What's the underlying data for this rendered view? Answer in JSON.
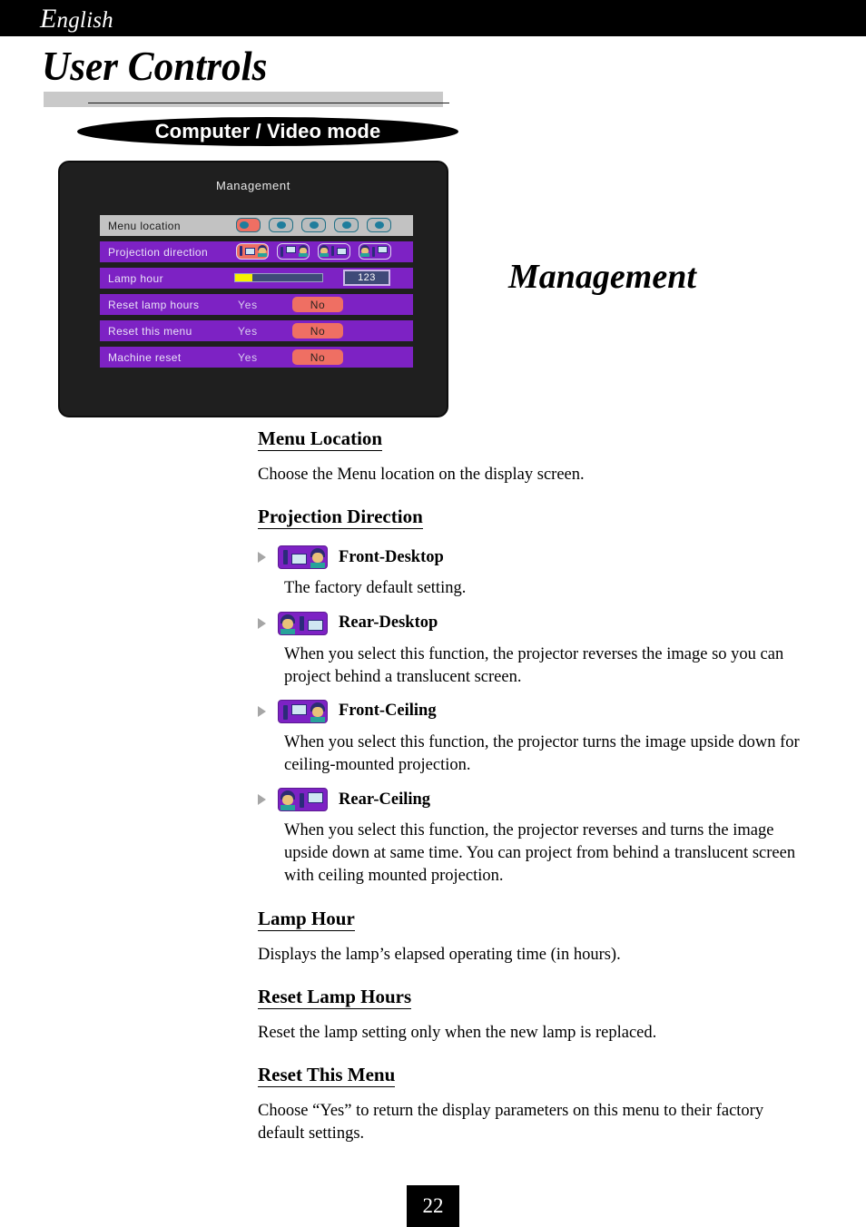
{
  "header": {
    "language": "English",
    "language_cap": "E",
    "language_rest": "nglish",
    "page_title": "User Controls",
    "mode_banner": "Computer / Video mode"
  },
  "side_heading": "Management",
  "osd": {
    "title": "Management",
    "rows": [
      {
        "label": "Menu location",
        "type": "menu-location",
        "selected": true,
        "options": [
          {
            "dot": "left",
            "active": true
          },
          {
            "dot": "center",
            "active": false
          },
          {
            "dot": "center",
            "active": false
          },
          {
            "dot": "center",
            "active": false
          },
          {
            "dot": "center",
            "active": false
          }
        ]
      },
      {
        "label": "Projection direction",
        "type": "projection-direction",
        "selected": false,
        "options": [
          {
            "mode": "front-desktop",
            "active": true
          },
          {
            "mode": "front-ceiling",
            "active": false
          },
          {
            "mode": "rear-desktop",
            "active": false
          },
          {
            "mode": "rear-ceiling",
            "active": false
          }
        ]
      },
      {
        "label": "Lamp hour",
        "type": "lamp-hour",
        "selected": false,
        "fill_percent": 20,
        "value": "123"
      },
      {
        "label": "Reset lamp hours",
        "type": "yes-no",
        "selected": false,
        "yes_label": "Yes",
        "no_label": "No",
        "chosen": "No"
      },
      {
        "label": "Reset this menu",
        "type": "yes-no",
        "selected": false,
        "yes_label": "Yes",
        "no_label": "No",
        "chosen": "No"
      },
      {
        "label": "Machine reset",
        "type": "yes-no",
        "selected": false,
        "yes_label": "Yes",
        "no_label": "No",
        "chosen": "No"
      }
    ]
  },
  "sections": {
    "menu_location": {
      "heading": "Menu Location",
      "body": "Choose the Menu location on the display screen."
    },
    "projection_direction": {
      "heading": "Projection Direction",
      "items": [
        {
          "icon": "front-desktop-icon",
          "label": "Front-Desktop",
          "body": "The factory default setting."
        },
        {
          "icon": "rear-desktop-icon",
          "label": "Rear-Desktop",
          "body": "When you select this function, the projector reverses the image so you can project behind a translucent screen."
        },
        {
          "icon": "front-ceiling-icon",
          "label": "Front-Ceiling",
          "body": "When you select this function, the projector turns the image upside down for ceiling-mounted projection."
        },
        {
          "icon": "rear-ceiling-icon",
          "label": "Rear-Ceiling",
          "body": "When you select this function, the projector reverses and turns the image upside down at same time. You can project from behind a translucent screen with ceiling mounted projection."
        }
      ]
    },
    "lamp_hour": {
      "heading": "Lamp Hour",
      "body": "Displays the lamp’s elapsed operating time (in hours)."
    },
    "reset_lamp_hours": {
      "heading": "Reset Lamp Hours",
      "body": "Reset the lamp setting only when the new lamp is replaced."
    },
    "reset_this_menu": {
      "heading": "Reset This Menu",
      "body": "Choose “Yes” to return the display parameters on this menu to their factory default settings."
    }
  },
  "footer": {
    "page_number": "22"
  },
  "colors": {
    "osd_row": "#7d22c4",
    "osd_row_selected": "#c2c2c2",
    "accent_red": "#ef6f63",
    "lamp_fill": "#f6f000",
    "icon_purple": "#7d22c4"
  }
}
